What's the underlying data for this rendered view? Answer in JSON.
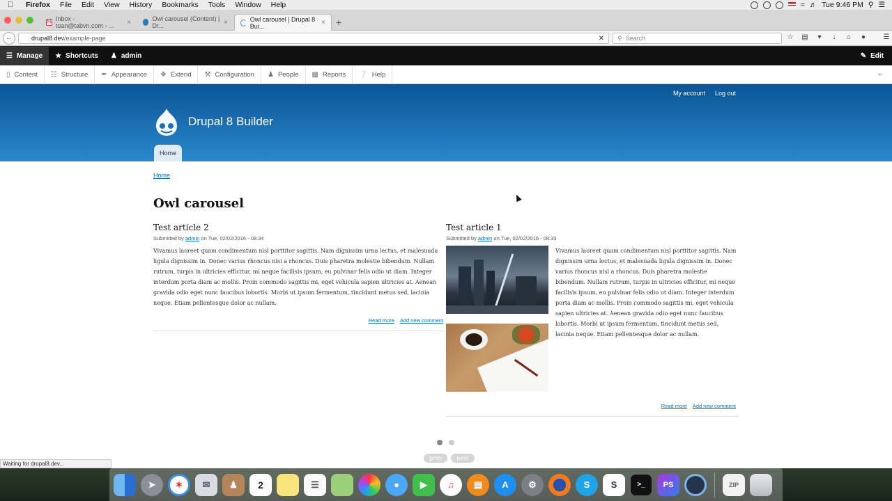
{
  "menubar": {
    "app_name": "Firefox",
    "menus": [
      "File",
      "Edit",
      "View",
      "History",
      "Bookmarks",
      "Tools",
      "Window",
      "Help"
    ],
    "clock": "Tue 9:46 PM"
  },
  "tabs": [
    {
      "title": "Inbox - toan@tabvn.com - ...",
      "icon": "gmail-icon"
    },
    {
      "title": "Owl carousel (Content) | Dr...",
      "icon": "drupal-icon"
    },
    {
      "title": "Owl carousel | Drupal 8 Bui...",
      "icon": "loading-icon"
    }
  ],
  "address": {
    "host": "drupal8.dev",
    "path": "/example-page"
  },
  "search": {
    "placeholder": "Search"
  },
  "toolbar": {
    "manage": "Manage",
    "shortcuts": "Shortcuts",
    "user": "admin",
    "edit": "Edit"
  },
  "tray": [
    "Content",
    "Structure",
    "Appearance",
    "Extend",
    "Configuration",
    "People",
    "Reports",
    "Help"
  ],
  "header": {
    "site_name": "Drupal 8 Builder",
    "secondary_menu": [
      "My account",
      "Log out"
    ],
    "main_menu": "Home"
  },
  "breadcrumb": "Home",
  "page_title": "Owl carousel",
  "articles": [
    {
      "title": "Test article 2",
      "submitted_prefix": "Submitted by",
      "author": "admin",
      "date": "on Tue, 02/02/2016 - 08:34",
      "body": "Vivamus laoreet quam condimentum nisl porttitor sagittis. Nam dignissim urna lectus, et malesuada ligula dignissim in. Donec varius rhoncus nisi a rhoncus. Duis pharetra molestie bibendum. Nullam rutrum, turpis in ultricies efficitur, mi neque facilisis ipsum, eu pulvinar felis odio ut diam. Integer interdum porta diam ac mollis. Proin commodo sagittis mi, eget vehicula sapien ultricies at. Aenean gravida odio eget nunc faucibus lobortis. Morbi ut ipsum fermentum, tincidunt metus sed, lacinia neque. Etiam pellentesque dolor ac nullam.",
      "read_more": "Read more",
      "add_comment": "Add new comment"
    },
    {
      "title": "Test article 1",
      "submitted_prefix": "Submitted by",
      "author": "admin",
      "date": "on Tue, 02/02/2016 - 08:33",
      "body": "Vivamus laoreet quam condimentum nisl porttitor sagittis. Nam dignissim urna lectus, et malesuada ligula dignissim in. Donec varius rhoncus nisi a rhoncus. Duis pharetra molestie bibendum. Nullam rutrum, turpis in ultricies efficitur, mi neque facilisis ipsum, eu pulvinar felis odio ut diam. Integer interdum porta diam ac mollis. Proin commodo sagittis mi, eget vehicula sapien ultricies at. Aenean gravida odio eget nunc faucibus lobortis. Morbi ut ipsum fermentum, tincidunt metus sed, lacinia neque. Etiam pellentesque dolor ac nullam.",
      "read_more": "Read more",
      "add_comment": "Add new comment"
    }
  ],
  "carousel": {
    "prev": "prev",
    "next": "next",
    "active_dot": 1,
    "dot_count": 2
  },
  "status_text": "Waiting for drupal8.dev...",
  "colors": {
    "header_top": "#0b5595",
    "header_bottom": "#2a88cc",
    "link": "#0071b3",
    "toolbar": "#0f0f0f"
  },
  "dock_apps": [
    "Finder",
    "Launchpad",
    "Safari",
    "Mail",
    "Contacts",
    "Calendar",
    "Notes",
    "Reminders",
    "Maps",
    "Photos",
    "Messages",
    "FaceTime",
    "iTunes",
    "iBooks",
    "App Store",
    "System Preferences",
    "Firefox",
    "Skype",
    "Slack",
    "Terminal",
    "PhpStorm",
    "QuickTime Player",
    "Archive",
    "Trash"
  ]
}
